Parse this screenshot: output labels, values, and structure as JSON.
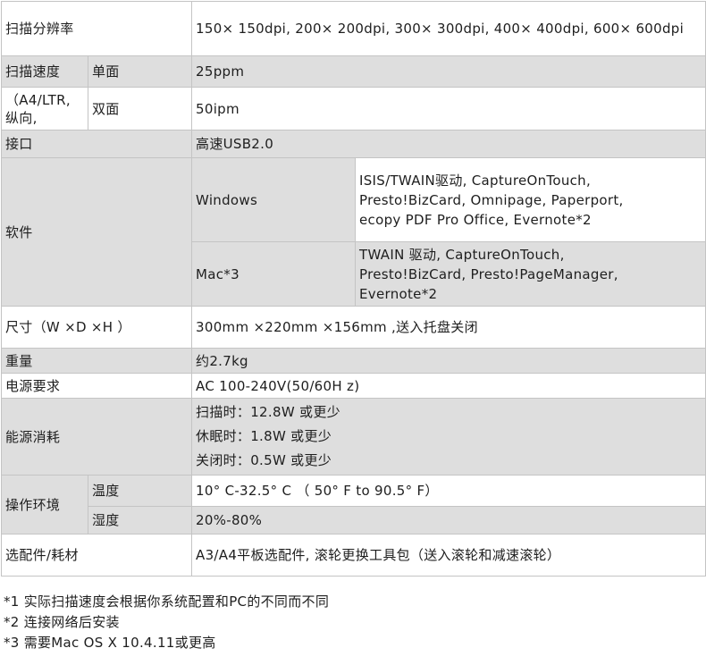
{
  "rows": {
    "resolution": {
      "label": "扫描分辨率",
      "value": "150× 150dpi, 200× 200dpi, 300× 300dpi, 400× 400dpi, 600× 600dpi"
    },
    "speed": {
      "label": "扫描速度",
      "label_note": "（A4/LTR,纵向,",
      "simplex": {
        "label": "单面",
        "value": "25ppm"
      },
      "duplex": {
        "label": "双面",
        "value": "50ipm"
      }
    },
    "interface": {
      "label": "接口",
      "value": "高速USB2.0"
    },
    "software": {
      "label": "软件",
      "windows": {
        "label": "Windows",
        "lines": [
          "ISIS/TWAIN驱动, CaptureOnTouch,",
          "Presto!BizCard, Omnipage, Paperport,",
          "ecopy PDF Pro Office, Evernote*2"
        ]
      },
      "mac": {
        "label": "Mac*3",
        "lines": [
          "TWAIN 驱动, CaptureOnTouch,",
          "Presto!BizCard, Presto!PageManager,",
          "Evernote*2"
        ]
      }
    },
    "size": {
      "label": "尺寸（W ×D ×H ）",
      "value": "300mm ×220mm ×156mm ,送入托盘关闭"
    },
    "weight": {
      "label": "重量",
      "value": "约2.7kg"
    },
    "power_req": {
      "label": "电源要求",
      "value": "AC 100-240V(50/60H z)"
    },
    "power_use": {
      "label": "能源消耗",
      "lines": [
        "扫描时：12.8W 或更少",
        "休眠时：1.8W 或更少",
        "关闭时：0.5W 或更少"
      ]
    },
    "environment": {
      "label": "操作环境",
      "temperature": {
        "label": "温度",
        "value": "10° C-32.5° C （ 50° F to 90.5° F）"
      },
      "humidity": {
        "label": "湿度",
        "value": "20%-80%"
      }
    },
    "options": {
      "label": "选配件/耗材",
      "value": "A3/A4平板选配件, 滚轮更换工具包（送入滚轮和减速滚轮）"
    }
  },
  "notes": [
    "*1 实际扫描速度会根据你系统配置和PC的不同而不同",
    "*2 连接网络后安装",
    "*3 需要Mac OS X 10.4.11或更高"
  ],
  "colors": {
    "row_gray": "#dedede",
    "border": "#c4c4c4",
    "text": "#1e1e1e"
  }
}
